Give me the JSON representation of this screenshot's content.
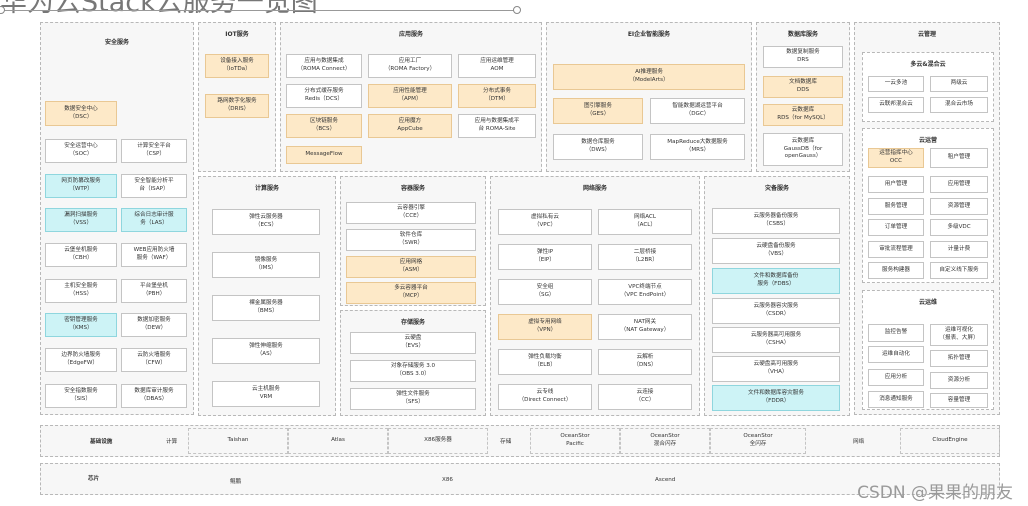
{
  "title": "华为云Stack云服务一览图",
  "watermark": "CSDN @果果的朋友",
  "security": {
    "title": "安全服务",
    "items": [
      "数据安全中心\n（DSC）",
      "安全运营中心\n（SOC）",
      "计算安全平台\n（CSP）",
      "网页防篡改服务\n（WTP）",
      "安全智能分析平\n台（ISAP）",
      "漏洞扫描服务\n（VSS）",
      "综合日志审计服\n务（LAS）",
      "云堡垒机服务\n（CBH）",
      "WEB应用防火墙\n服务（WAF）",
      "主机安全服务\n（HSS）",
      "平台堡垒机\n（PBH）",
      "密钥管理服务\n（KMS）",
      "数据加密服务\n（DEW）",
      "边界防火墙服务\n（EdgeFW）",
      "云防火墙服务\n（CFW）",
      "安全指数服务\n（SIS）",
      "数据库审计服务\n（DBAS）"
    ]
  },
  "iot": {
    "title": "IOT服务",
    "items": [
      "设备接入服务\n（IoTDa）",
      "路网数字化服务\n（DRIS）"
    ]
  },
  "app": {
    "title": "应用服务",
    "items": [
      "应用与数据集成\n（ROMA Connect）",
      "应用工厂\n（ROMA Factory）",
      "应用运维管理\nAOM",
      "分布式缓存服务\nRedis（DCS）",
      "应用性能管理\n（APM）",
      "分布式事务\n（DTM）",
      "区块链服务\n（BCS）",
      "应用魔方\nAppCube",
      "应用与数据集成平\n台 ROMA-Site",
      "MessageFlow"
    ]
  },
  "ei": {
    "title": "EI企业智能服务",
    "items": [
      "AI推理服务\n（ModelArts）",
      "图引擎服务\n（GES）",
      "智能数据湖运营平台\n（DGC）",
      "数据仓库服务\n（DWS）",
      "MapReduce大数据服务\n（MRS）"
    ]
  },
  "db": {
    "title": "数据库服务",
    "items": [
      "数据复制服务\nDRS",
      "文档数据库\nDDS",
      "云数据库\nRDS（for MySQL）",
      "云数据库\nGaussDB（for\nopenGauss）"
    ]
  },
  "mgmt": {
    "title": "云管理",
    "hybrid": {
      "title": "多云&混合云",
      "items": [
        "一云多池",
        "两级云",
        "云联邦混合云",
        "混合云市场"
      ]
    },
    "ops": {
      "title": "云运营",
      "items": [
        "运营指挥中心\nOCC",
        "租户管理",
        "用户管理",
        "应用管理",
        "服务管理",
        "资源管理",
        "订单管理",
        "多级VDC",
        "审批流程管理",
        "计量计费",
        "服务构建器",
        "自定义线下服务"
      ]
    },
    "om": {
      "title": "云运维",
      "items": [
        "监控告警",
        "运维可视化\n（报表、大屏）",
        "运维自动化",
        "拓扑管理",
        "应用分析",
        "资源分析",
        "消息通知服务",
        "容量管理"
      ]
    }
  },
  "compute": {
    "title": "计算服务",
    "items": [
      "弹性云服务器\n（ECS）",
      "镜像服务\n（IMS）",
      "裸金属服务器\n（BMS）",
      "弹性伸缩服务\n（AS）",
      "云主机服务\nVRM"
    ]
  },
  "container": {
    "title": "容器服务",
    "items": [
      "云容器引擎\n（CCE）",
      "软件仓库\n（SWR）",
      "应用网格\n（ASM）",
      "多云容器平台\n（MCP）"
    ]
  },
  "storage": {
    "title": "存储服务",
    "items": [
      "云硬盘\n（EVS）",
      "对象存储服务 3.0\n（OBS 3.0）",
      "弹性文件服务\n（SFS）"
    ]
  },
  "network": {
    "title": "网络服务",
    "items": [
      "虚拟私有云\n（VPC）",
      "网络ACL\n（ACL）",
      "弹性IP\n（EIP）",
      "二层桥接\n（L2BR）",
      "安全组\n（SG）",
      "VPC终端节点\n（VPC EndPoint）",
      "虚拟专用网络\n（VPN）",
      "NAT网关\n（NAT Gateway）",
      "弹性负载均衡\n（ELB）",
      "云解析\n（DNS）",
      "云专线\n（Direct Connect）",
      "云连接\n（CC）"
    ]
  },
  "dr": {
    "title": "灾备服务",
    "items": [
      "云服务器备份服务\n（CSBS）",
      "云硬盘备份服务\n（VBS）",
      "文件和数据库备份\n服务（FDBS）",
      "云服务器容灾服务\n（CSDR）",
      "云服务器高可用服务\n（CSHA）",
      "云硬盘高可用服务\n（VHA）",
      "文件和数据库容灾服务\n（FDDR）"
    ]
  },
  "infra": {
    "title": "基础设施",
    "compute_label": "计算",
    "compute": [
      "Taishan",
      "Atlas",
      "X86服务器"
    ],
    "storage_label": "存储",
    "storage": [
      "OceanStor\nPacific",
      "OceanStor\n混合闪存",
      "OceanStor\n全闪存"
    ],
    "network_label": "网络",
    "network": [
      "CloudEngine"
    ]
  },
  "chip": {
    "title": "芯片",
    "items": [
      "鲲鹏",
      "X86",
      "Ascend"
    ]
  }
}
